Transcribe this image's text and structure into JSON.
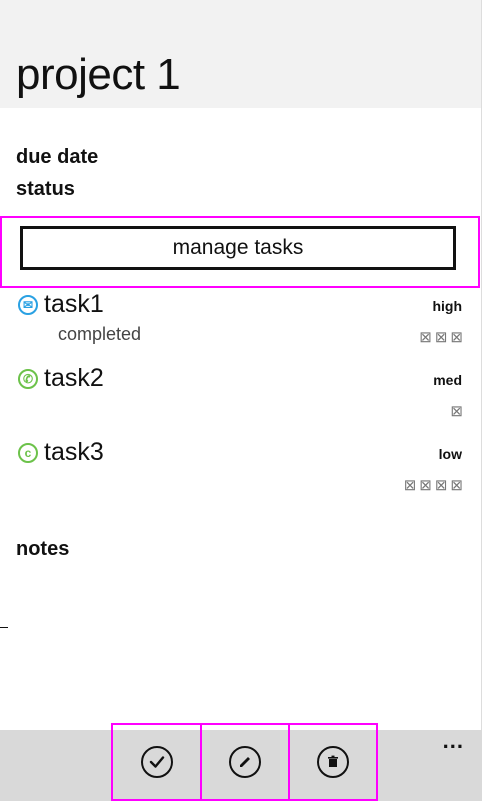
{
  "header": {
    "title": "project 1"
  },
  "fields": {
    "due_date_label": "due date",
    "status_label": "status"
  },
  "manage_tasks_label": "manage tasks",
  "tasks": [
    {
      "name": "task1",
      "status": "completed",
      "priority": "high",
      "boxes": "⊠⊠⊠",
      "icon": "message-icon",
      "icon_color": "#2aa1e3"
    },
    {
      "name": "task2",
      "status": "",
      "priority": "med",
      "boxes": "⊠",
      "icon": "phone-icon",
      "icon_color": "#6cc24a"
    },
    {
      "name": "task3",
      "status": "",
      "priority": "low",
      "boxes": "⊠⊠⊠⊠",
      "icon": "contact-icon",
      "icon_color": "#6cc24a"
    }
  ],
  "notes_label": "notes",
  "app_bar": {
    "buttons": [
      {
        "name": "complete",
        "icon": "check-icon"
      },
      {
        "name": "edit",
        "icon": "pencil-icon"
      },
      {
        "name": "delete",
        "icon": "trash-icon"
      }
    ],
    "more_label": "..."
  },
  "colors": {
    "accent_highlight": "#ff00ff",
    "app_bar_bg": "#d9d9d9",
    "header_bg": "#f2f2f2"
  }
}
